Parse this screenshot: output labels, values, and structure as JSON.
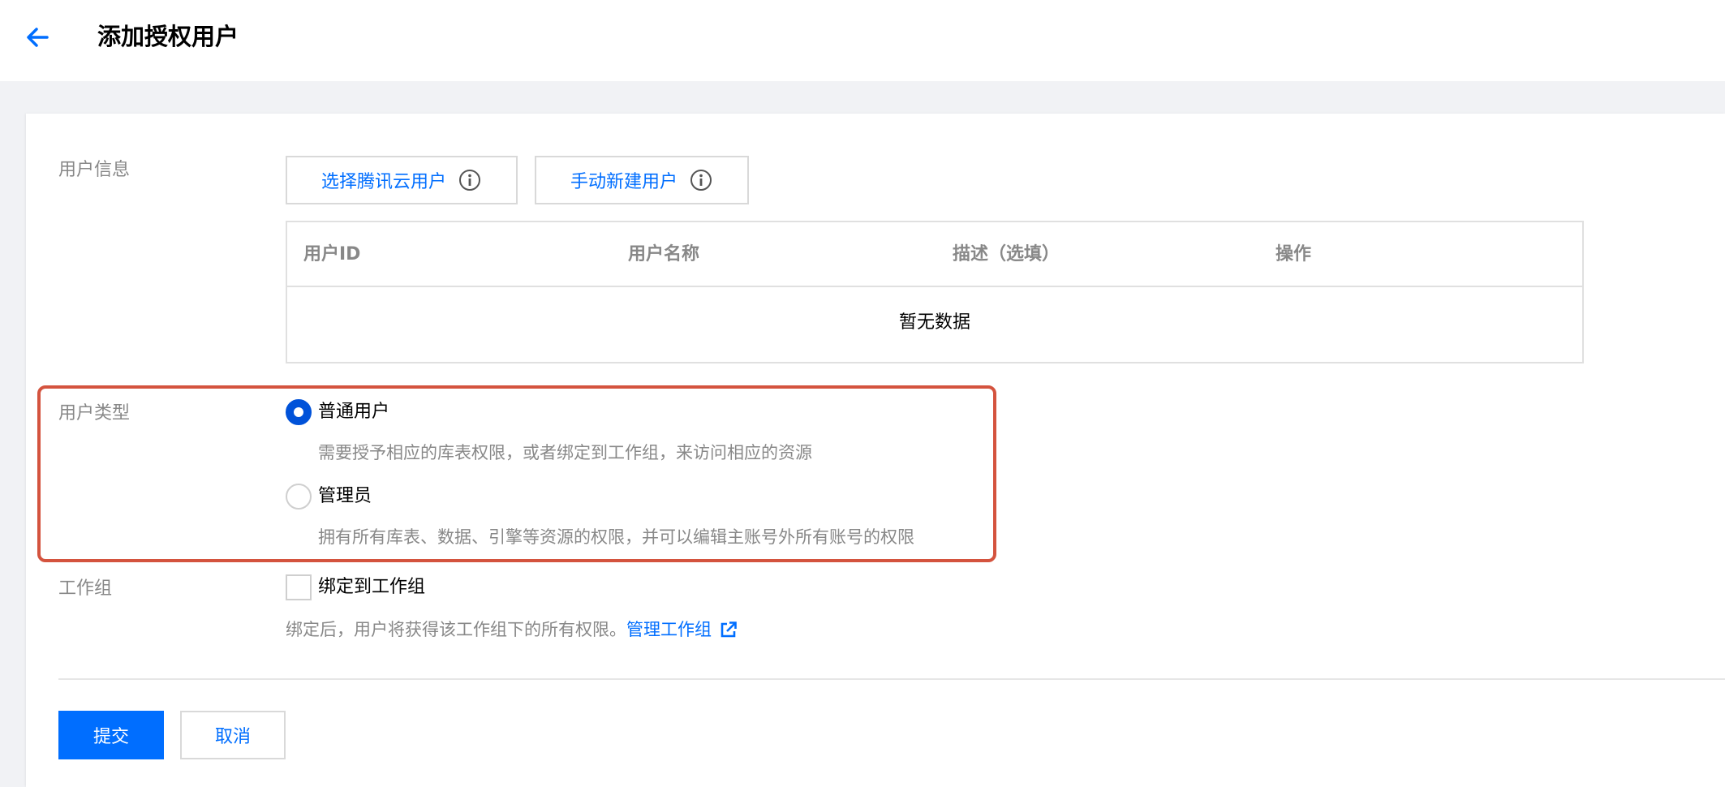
{
  "header": {
    "title": "添加授权用户",
    "back_icon": "arrow-left-icon"
  },
  "user_info": {
    "label": "用户信息",
    "select_button": "选择腾讯云用户",
    "create_button": "手动新建用户",
    "table": {
      "columns": [
        "用户ID",
        "用户名称",
        "描述（选填）",
        "操作"
      ],
      "empty_text": "暂无数据"
    }
  },
  "user_type": {
    "label": "用户类型",
    "options": [
      {
        "label": "普通用户",
        "description": "需要授予相应的库表权限，或者绑定到工作组，来访问相应的资源",
        "checked": true
      },
      {
        "label": "管理员",
        "description": "拥有所有库表、数据、引擎等资源的权限，并可以编辑主账号外所有账号的权限",
        "checked": false
      }
    ]
  },
  "workgroup": {
    "label": "工作组",
    "checkbox_label": "绑定到工作组",
    "checked": false,
    "help_text": "绑定后，用户将获得该工作组下的所有权限。",
    "manage_link": "管理工作组"
  },
  "actions": {
    "submit": "提交",
    "cancel": "取消"
  },
  "colors": {
    "accent": "#006eff",
    "highlight_border": "#d4533e"
  }
}
